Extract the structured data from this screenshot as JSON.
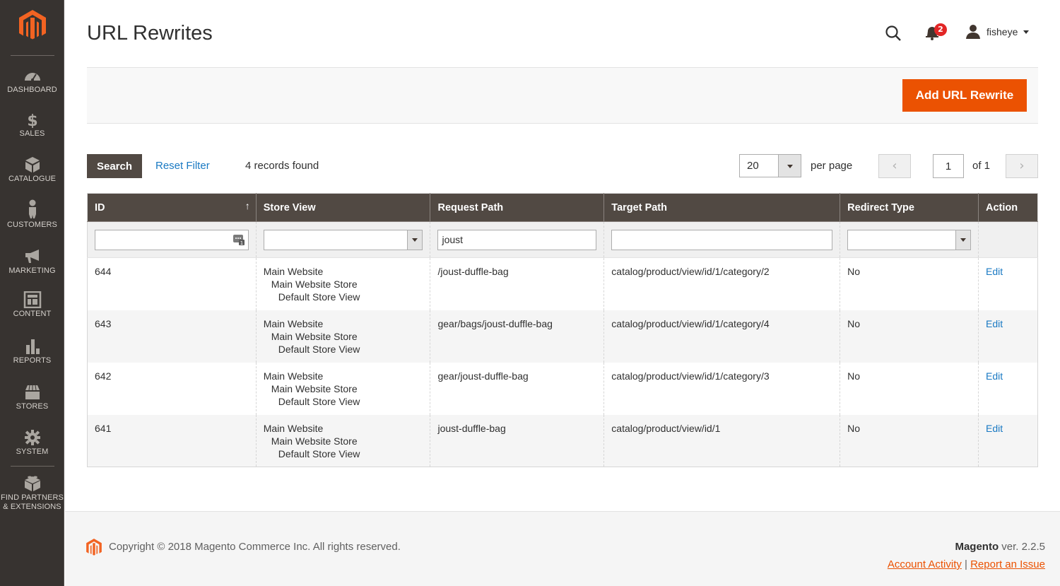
{
  "sidebar": {
    "items": [
      {
        "label": "DASHBOARD",
        "icon": "dashboard-icon"
      },
      {
        "label": "SALES",
        "icon": "dollar-icon"
      },
      {
        "label": "CATALOGUE",
        "icon": "box-icon"
      },
      {
        "label": "CUSTOMERS",
        "icon": "person-icon"
      },
      {
        "label": "MARKETING",
        "icon": "megaphone-icon"
      },
      {
        "label": "CONTENT",
        "icon": "layout-icon"
      },
      {
        "label": "REPORTS",
        "icon": "bar-chart-icon"
      },
      {
        "label": "STORES",
        "icon": "storefront-icon"
      },
      {
        "label": "SYSTEM",
        "icon": "gear-icon"
      }
    ],
    "extensions": {
      "line1": "FIND PARTNERS",
      "line2": "& EXTENSIONS",
      "icon": "lego-brick-icon"
    }
  },
  "header": {
    "title": "URL Rewrites",
    "notifications_count": "2",
    "username": "fisheye"
  },
  "action_bar": {
    "add_button": "Add URL Rewrite"
  },
  "grid_controls": {
    "search_button": "Search",
    "reset_filter": "Reset Filter",
    "records_found": "4 records found",
    "per_page_value": "20",
    "per_page_label": "per page",
    "page_current": "1",
    "page_of": "of 1",
    "prev_glyph": "‹",
    "next_glyph": "›"
  },
  "table": {
    "columns": [
      "ID",
      "Store View",
      "Request Path",
      "Target Path",
      "Redirect Type",
      "Action"
    ],
    "sort_indicator": "↑",
    "filters": {
      "id": "",
      "store_view": "",
      "request_path": "joust",
      "target_path": "",
      "redirect_type": ""
    },
    "rows": [
      {
        "id": "644",
        "store_view": [
          "Main Website",
          "Main Website Store",
          "Default Store View"
        ],
        "request_path": "/joust-duffle-bag",
        "target_path": "catalog/product/view/id/1/category/2",
        "redirect_type": "No",
        "action": "Edit"
      },
      {
        "id": "643",
        "store_view": [
          "Main Website",
          "Main Website Store",
          "Default Store View"
        ],
        "request_path": "gear/bags/joust-duffle-bag",
        "target_path": "catalog/product/view/id/1/category/4",
        "redirect_type": "No",
        "action": "Edit"
      },
      {
        "id": "642",
        "store_view": [
          "Main Website",
          "Main Website Store",
          "Default Store View"
        ],
        "request_path": "gear/joust-duffle-bag",
        "target_path": "catalog/product/view/id/1/category/3",
        "redirect_type": "No",
        "action": "Edit"
      },
      {
        "id": "641",
        "store_view": [
          "Main Website",
          "Main Website Store",
          "Default Store View"
        ],
        "request_path": "joust-duffle-bag",
        "target_path": "catalog/product/view/id/1",
        "redirect_type": "No",
        "action": "Edit"
      }
    ]
  },
  "footer": {
    "copyright": "Copyright © 2018 Magento Commerce Inc. All rights reserved.",
    "brand": "Magento",
    "version": " ver. 2.2.5",
    "account_activity": "Account Activity",
    "separator": " | ",
    "report_issue": "Report an Issue"
  },
  "colors": {
    "brand_orange": "#eb5202",
    "sidebar_bg": "#373330",
    "table_header_bg": "#514943",
    "link_blue": "#1979c3",
    "badge_red": "#e22626"
  }
}
